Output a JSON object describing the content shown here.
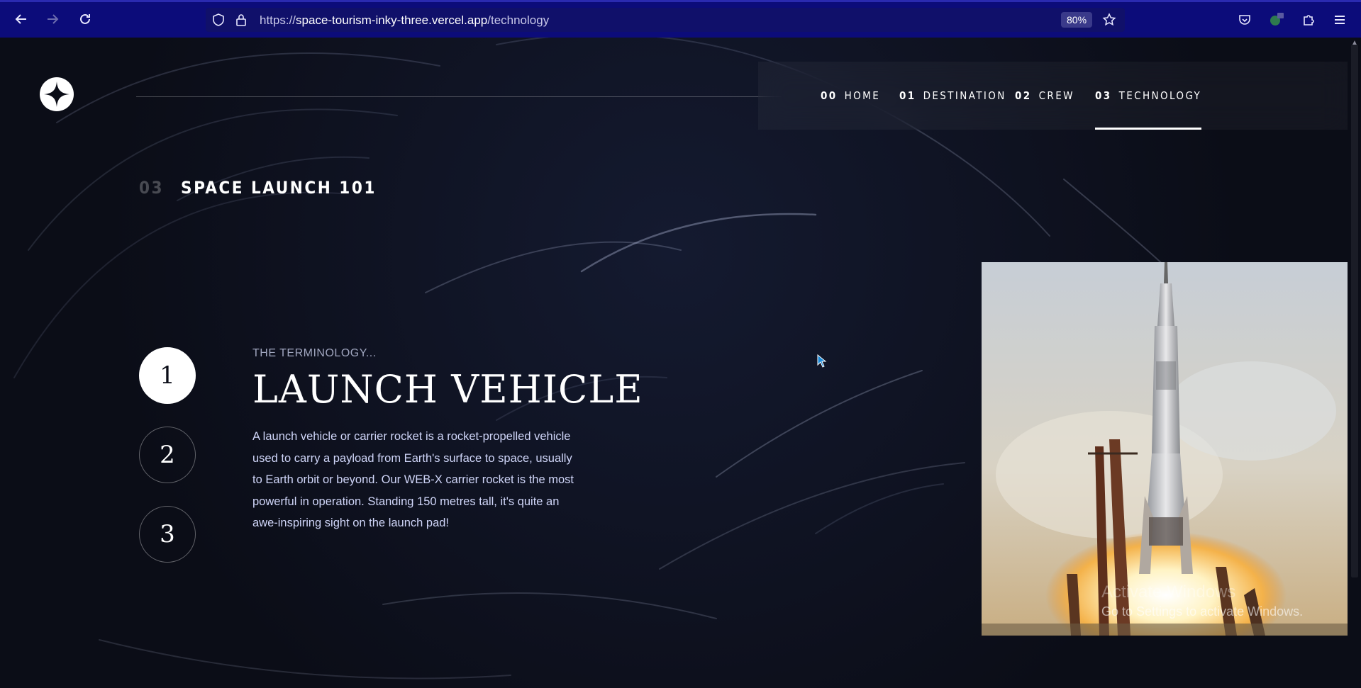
{
  "browser": {
    "url_prefix": "https://",
    "url_host": "space-tourism-inky-three.vercel.app",
    "url_path": "/technology",
    "zoom": "80%"
  },
  "nav": {
    "items": [
      {
        "num": "00",
        "label": "HOME"
      },
      {
        "num": "01",
        "label": "DESTINATION"
      },
      {
        "num": "02",
        "label": "CREW"
      },
      {
        "num": "03",
        "label": "TECHNOLOGY"
      }
    ],
    "active_index": 3
  },
  "section": {
    "num": "03",
    "heading": "SPACE LAUNCH 101"
  },
  "steps": [
    "1",
    "2",
    "3"
  ],
  "content": {
    "eyebrow": "THE TERMINOLOGY...",
    "title": "LAUNCH VEHICLE",
    "description": "A launch vehicle or carrier rocket is a rocket-propelled vehicle used to carry a payload from Earth's surface to space, usually to Earth orbit or beyond. Our WEB-X carrier rocket is the most powerful in operation. Standing 150 metres tall, it's quite an awe-inspiring sight on the launch pad!"
  },
  "watermark": {
    "line1": "Activate Windows",
    "line2": "Go to Settings to activate Windows."
  },
  "colors": {
    "browser_bar": "#0c0c7a",
    "page_bg": "#0b0d17",
    "text_secondary": "#d0d6f9"
  }
}
